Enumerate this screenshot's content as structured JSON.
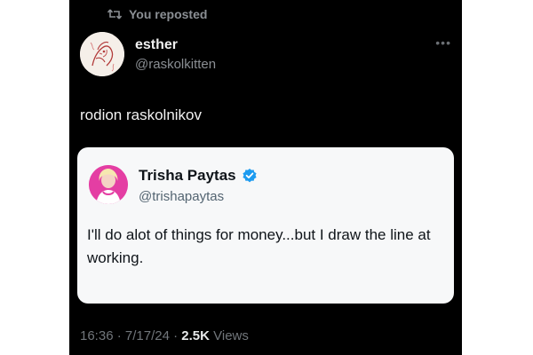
{
  "repost": {
    "label": "You reposted",
    "icon": "repost-icon"
  },
  "author": {
    "name": "esther",
    "handle": "@raskolkitten",
    "avatar_icon": "sketch-avatar"
  },
  "post": {
    "text": "rodion raskolnikov",
    "more_icon": "more-options-icon"
  },
  "quoted_post": {
    "name": "Trisha Paytas",
    "handle": "@trishapaytas",
    "verified_icon": "verified-badge-icon",
    "verified_color": "#1d9bf0",
    "avatar_color": "#e43ea3",
    "text": "I'll do alot of things for money...but I draw the line at working."
  },
  "meta": {
    "time": "16:36",
    "separator": "·",
    "date": "7/17/24",
    "views_count": "2.5K",
    "views_label": "Views"
  },
  "colors": {
    "background": "#000000",
    "card": "#f7f8f9",
    "muted_text": "#71767b"
  }
}
